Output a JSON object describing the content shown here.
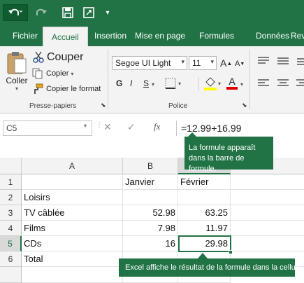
{
  "quick_access": {
    "undo_icon": "undo-icon",
    "redo_icon": "redo-icon",
    "save_icon": "save-icon",
    "touch_mode_icon": "touch-mode-icon",
    "customize_icon": "customize-toolbar-icon"
  },
  "tabs": [
    "Fichier",
    "Accueil",
    "Insertion",
    "Mise en page",
    "Formules",
    "Données",
    "Rev"
  ],
  "active_tab": "Accueil",
  "ribbon": {
    "clipboard": {
      "paste_label": "Coller",
      "cut_label": "Couper",
      "copy_label": "Copier",
      "format_painter_label": "Copier le format",
      "group_label": "Presse-papiers"
    },
    "font": {
      "font_name": "Segoe UI Light",
      "font_size": "11",
      "bold": "G",
      "italic": "I",
      "underline": "S",
      "increase_font": "A",
      "decrease_font": "A",
      "font_color_letter": "A",
      "group_label": "Police",
      "highlight_color": "#ffff00",
      "font_color": "#e00000"
    }
  },
  "formula_bar": {
    "name_box": "C5",
    "cancel": "✕",
    "enter": "✓",
    "fx": "fx",
    "formula": "=12.99+16.99"
  },
  "callouts": {
    "formula_bar_note": "La formule apparaît dans la barre de formule.",
    "result_note": "Excel affiche le résultat de la formule dans la cellule."
  },
  "sheet": {
    "columns": [
      "A",
      "B",
      "C"
    ],
    "rows": [
      "1",
      "2",
      "3",
      "4",
      "5",
      "6"
    ],
    "cells": {
      "B1": "Janvier",
      "C1": "Février",
      "A2": "Loisirs",
      "A3": "TV câblée",
      "B3": "52.98",
      "C3": "63.25",
      "A4": "Films",
      "B4": "7.98",
      "C4": "11.97",
      "A5": "CDs",
      "B5": "16",
      "C5": "29.98",
      "A6": "Total"
    },
    "active_cell": "C5"
  },
  "colors": {
    "accent": "#217346",
    "ribbon_bg": "#f3f3f3"
  }
}
